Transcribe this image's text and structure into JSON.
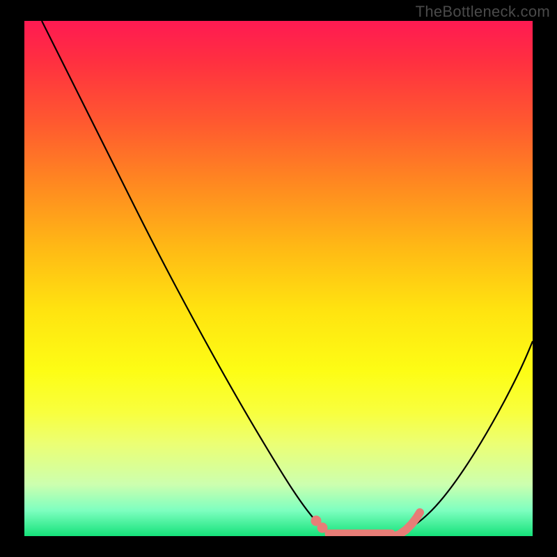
{
  "watermark": "TheBottleneck.com",
  "chart_data": {
    "type": "line",
    "title": "",
    "xlabel": "",
    "ylabel": "",
    "xlim": [
      0,
      100
    ],
    "ylim": [
      0,
      100
    ],
    "series": [
      {
        "name": "bottleneck-curve",
        "x": [
          0,
          10,
          20,
          30,
          40,
          50,
          55,
          58,
          62,
          66,
          70,
          75,
          80,
          85,
          90,
          95,
          100
        ],
        "y": [
          100,
          88,
          75,
          62,
          48,
          30,
          18,
          8,
          2,
          0,
          0,
          1,
          6,
          15,
          26,
          38,
          50
        ]
      }
    ],
    "flat_zone": {
      "name": "flat-highlight",
      "x_start": 58,
      "x_end": 74,
      "y": 1
    },
    "colors": {
      "curve": "#000000",
      "highlight": "#e77d77",
      "bg_top": "#ff1a52",
      "bg_bottom": "#15e27a"
    }
  }
}
